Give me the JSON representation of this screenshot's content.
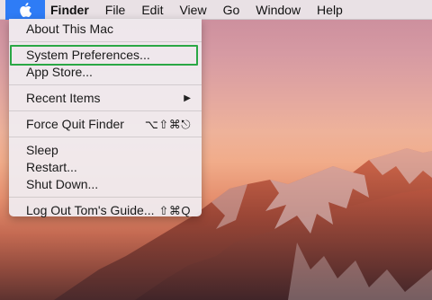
{
  "menubar": {
    "apple_icon": "apple-logo-icon",
    "app_name": "Finder",
    "menus": [
      "File",
      "Edit",
      "View",
      "Go",
      "Window",
      "Help"
    ]
  },
  "apple_menu": {
    "items": [
      {
        "label": "About This Mac",
        "shortcut": ""
      },
      {
        "label": "System Preferences...",
        "shortcut": "",
        "highlighted": true
      },
      {
        "label": "App Store...",
        "shortcut": ""
      },
      {
        "label": "Recent Items",
        "shortcut": "",
        "submenu": "▶"
      },
      {
        "label": "Force Quit Finder",
        "shortcut": "⌥⇧⌘⎋"
      },
      {
        "label": "Sleep",
        "shortcut": ""
      },
      {
        "label": "Restart...",
        "shortcut": ""
      },
      {
        "label": "Shut Down...",
        "shortcut": ""
      },
      {
        "label": "Log Out Tom's Guide...",
        "shortcut": "⇧⌘Q"
      }
    ]
  },
  "colors": {
    "apple_button": "#2e7cf6",
    "highlight_outline": "#2aa745"
  }
}
